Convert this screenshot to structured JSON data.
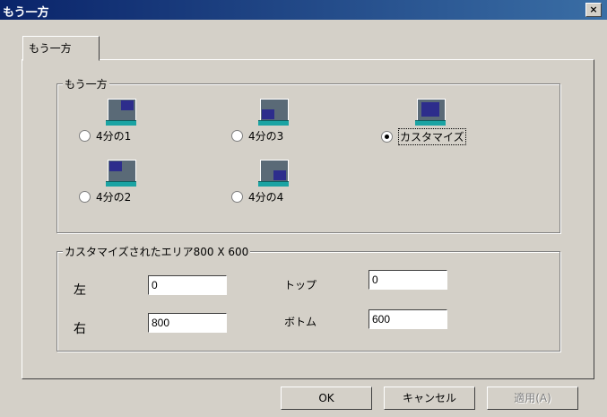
{
  "window": {
    "title": "もう一方",
    "close_label": "×"
  },
  "tab": {
    "label": "もう一方"
  },
  "position_group": {
    "legend": "もう一方",
    "options": [
      {
        "label": "4分の1",
        "selected": false
      },
      {
        "label": "4分の3",
        "selected": false
      },
      {
        "label": "カスタマイズ",
        "selected": true
      },
      {
        "label": "4分の2",
        "selected": false
      },
      {
        "label": "4分の4",
        "selected": false
      }
    ]
  },
  "custom_group": {
    "legend": "カスタマイズされたエリア800 X 600",
    "left_label": "左",
    "left_value": "0",
    "top_label": "トップ",
    "top_value": "0",
    "right_label": "右",
    "right_value": "800",
    "bottom_label": "ボトム",
    "bottom_value": "600"
  },
  "buttons": {
    "ok": "OK",
    "cancel": "キャンセル",
    "apply": "適用(A)"
  },
  "colors": {
    "title_bar": "#0a246a",
    "dialog_bg": "#d4d0c8",
    "monitor_window": "#2d2d8c",
    "monitor_base": "#1aa3a3"
  }
}
